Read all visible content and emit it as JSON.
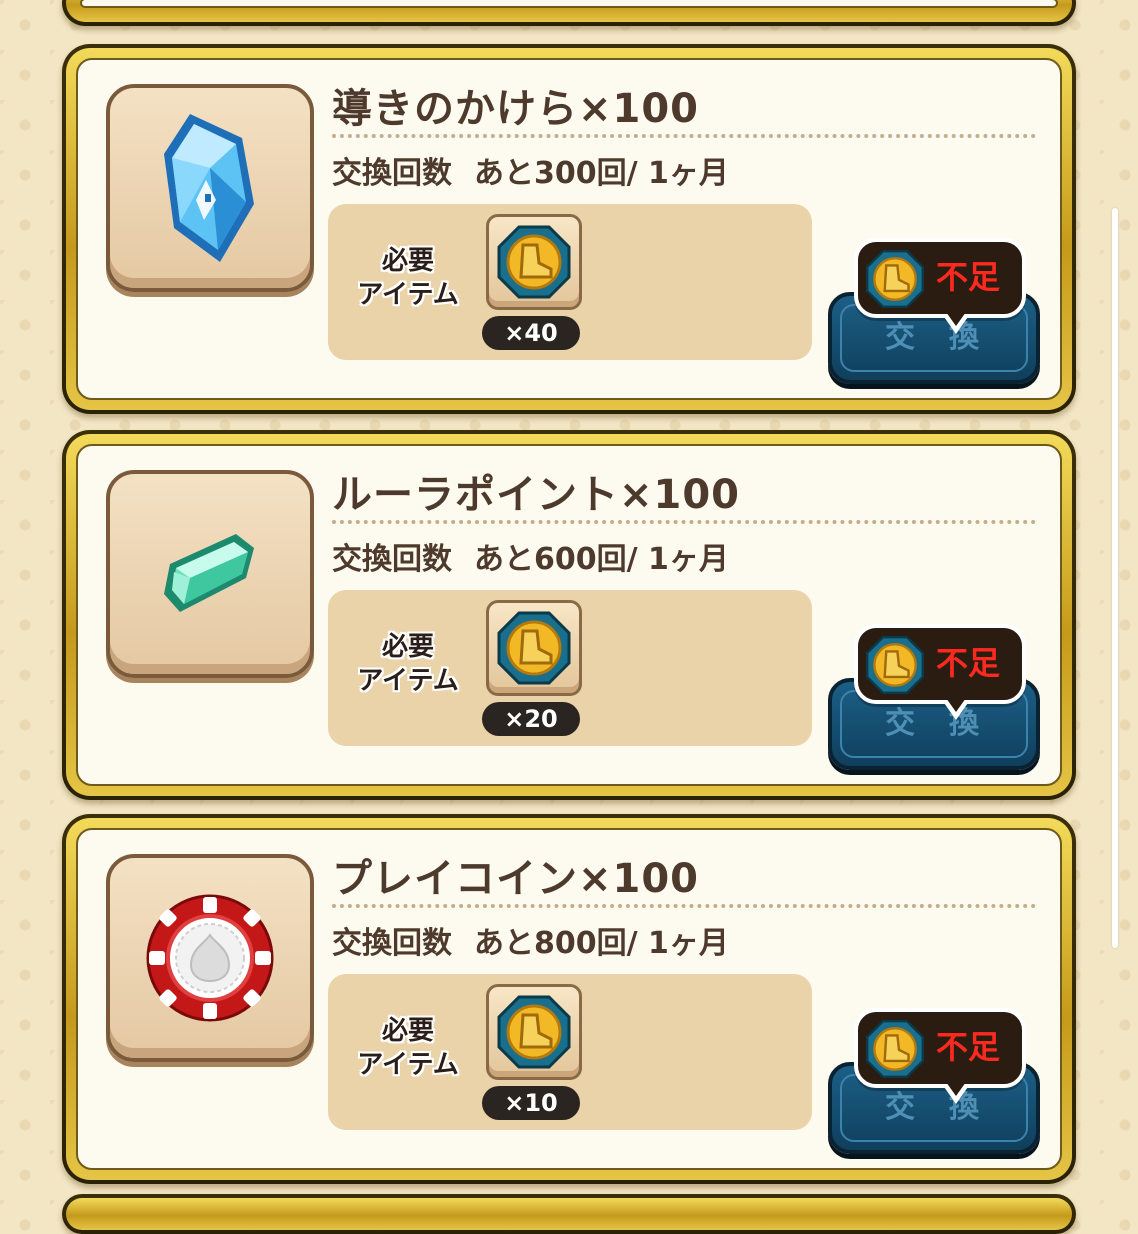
{
  "cards": [
    {
      "title": "導きのかけら×100",
      "count_label": "交換回数",
      "count_value": "あと300回/ 1ヶ月",
      "required_label": "必要アイテム",
      "required_qty": "×40",
      "insufficient_label": "不足",
      "exchange_label": "交換",
      "icon": "blue-crystal-icon"
    },
    {
      "title": "ルーラポイント×100",
      "count_label": "交換回数",
      "count_value": "あと600回/ 1ヶ月",
      "required_label": "必要アイテム",
      "required_qty": "×20",
      "insufficient_label": "不足",
      "exchange_label": "交換",
      "icon": "green-crystal-icon"
    },
    {
      "title": "プレイコイン×100",
      "count_label": "交換回数",
      "count_value": "あと800回/ 1ヶ月",
      "required_label": "必要アイテム",
      "required_qty": "×10",
      "insufficient_label": "不足",
      "exchange_label": "交換",
      "icon": "play-coin-chip-icon"
    }
  ],
  "required_item_icon": "boot-medal-icon",
  "colors": {
    "gold_frame": "#d8b236",
    "card_bg": "#fdfbf0",
    "exchange_button": "#15506f",
    "insufficient_text": "#ff2a1f"
  }
}
